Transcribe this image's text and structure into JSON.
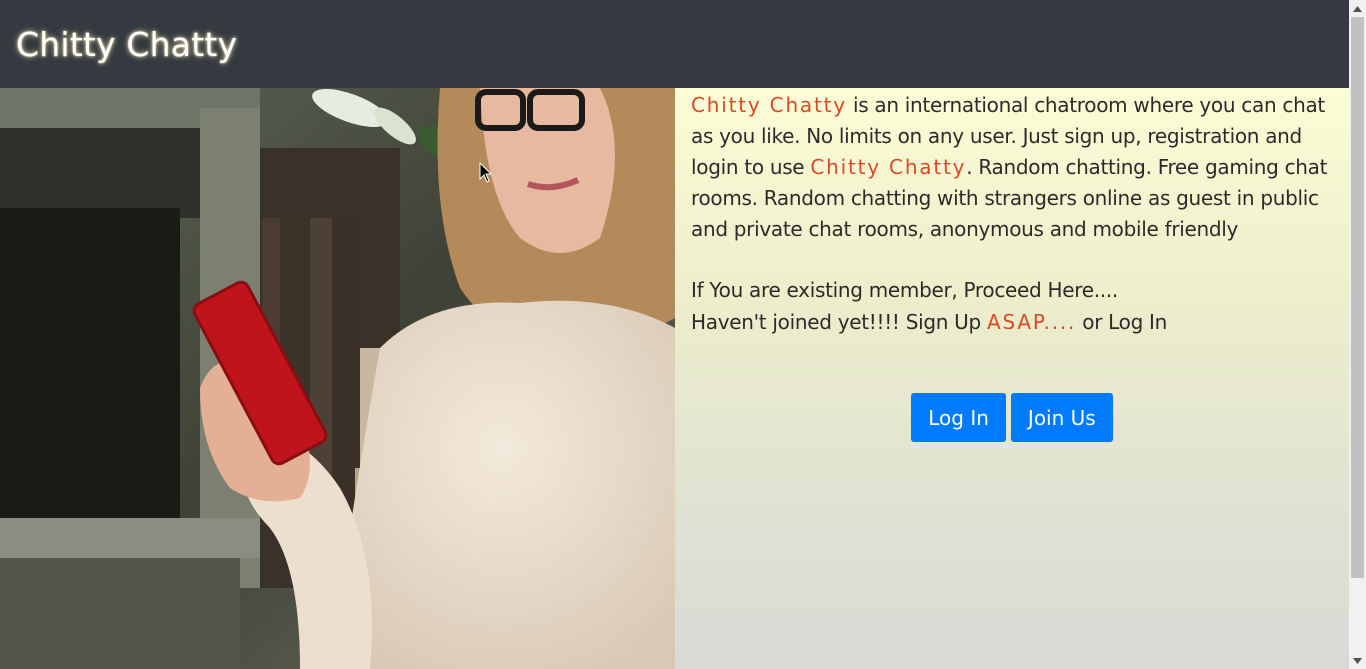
{
  "navbar": {
    "brand": "Chitty Chatty"
  },
  "hero": {
    "image_name": "woman-with-phone-photo"
  },
  "intro": {
    "brand1": "Chitty Chatty",
    "text1": " is an international chatroom where you can chat as you like. No limits on any user. Just sign up, registration and login to use ",
    "brand2": "Chitty Chatty",
    "text2": ". Random chatting. Free gaming chat rooms. Random chatting with strangers online as guest in public and private chat rooms, anonymous and mobile friendly"
  },
  "member": {
    "line1": "If You are existing member, Proceed Here....",
    "line2_before": "Haven't joined yet!!!! Sign Up ",
    "line2_accent": "ASAP....",
    "line2_after": " or Log In"
  },
  "buttons": {
    "login": "Log In",
    "join": "Join Us"
  },
  "colors": {
    "navbar": "#343a40",
    "accent": "#d84a25",
    "button": "#007bff"
  }
}
